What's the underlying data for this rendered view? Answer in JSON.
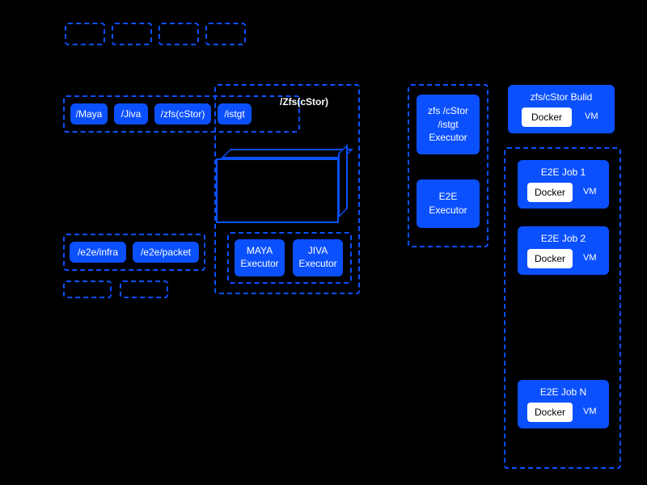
{
  "topRow": {
    "boxes": [
      "",
      "",
      "",
      ""
    ]
  },
  "repoGroup": {
    "items": [
      "/Maya",
      "/Jiva",
      "/zfs(cStor)",
      "/istgt"
    ],
    "label": "/Zfs(cStor)"
  },
  "e2eGroup": {
    "items": [
      "/e2e/infra",
      "/e2e/packet"
    ]
  },
  "executors": {
    "maya": "MAYA\nExecutor",
    "jiva": "JIVA\nExecutor",
    "zfs": "zfs /cStor\n/istgt\nExecutor",
    "e2e": "E2E\nExecutor"
  },
  "buildBox": {
    "title": "zfs/cStor Bulid",
    "docker": "Docker",
    "vm": "VM"
  },
  "e2eJobs": [
    {
      "title": "E2E Job 1",
      "docker": "Docker",
      "vm": "VM"
    },
    {
      "title": "E2E Job 2",
      "docker": "Docker",
      "vm": "VM"
    },
    {
      "title": "E2E Job N",
      "docker": "Docker",
      "vm": "VM"
    }
  ]
}
